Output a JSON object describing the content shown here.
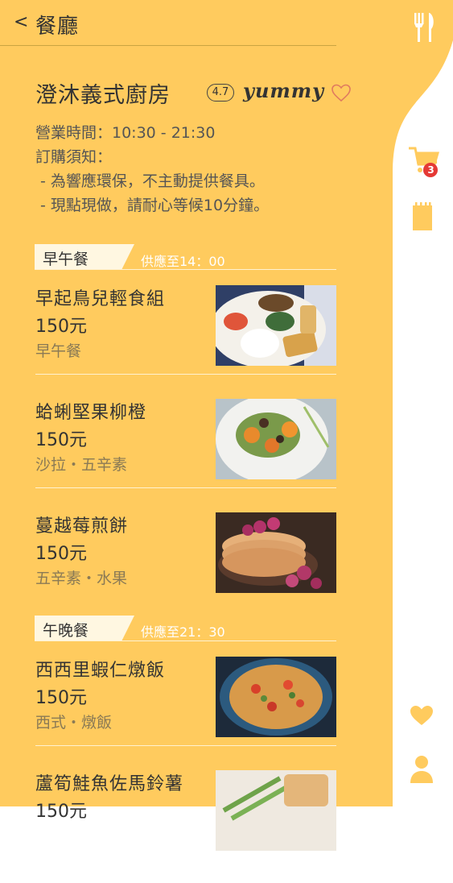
{
  "header": {
    "back_icon": "back-chevron-icon",
    "title": "餐廳"
  },
  "restaurant": {
    "name": "澄沐義式廚房",
    "rating": "4.7",
    "brand": "yummy",
    "hours": "營業時間：10:30 - 21:30",
    "notice_title": "訂購須知：",
    "notices": [
      "- 為響應環保，不主動提供餐具。",
      "- 現點現做，請耐心等候10分鐘。"
    ]
  },
  "sections": [
    {
      "label": "早午餐",
      "note": "供應至14：00",
      "items": [
        {
          "name": "早起鳥兒輕食組",
          "price": "150元",
          "tags": "早午餐",
          "photo": "breakfast-plate"
        },
        {
          "name": "蛤蜊堅果柳橙",
          "price": "150元",
          "tags": "沙拉・五辛素",
          "photo": "salad-bowl"
        },
        {
          "name": "蔓越莓煎餅",
          "price": "150元",
          "tags": "五辛素・水果",
          "photo": "pancakes"
        }
      ]
    },
    {
      "label": "午晚餐",
      "note": "供應至21：30",
      "items": [
        {
          "name": "西西里蝦仁燉飯",
          "price": "150元",
          "tags": "西式・燉飯",
          "photo": "shrimp-risotto"
        },
        {
          "name": "蘆筍鮭魚佐馬鈴薯",
          "price": "150元",
          "tags": "",
          "photo": "salmon-asparagus"
        }
      ]
    }
  ],
  "sidebar": {
    "cart_badge": "3",
    "icons": [
      "fork-knife-icon",
      "cart-icon",
      "notepad-icon",
      "heart-icon",
      "user-icon"
    ]
  },
  "colors": {
    "primary": "#ffcb5e",
    "text": "#333333",
    "muted": "#8a7a55",
    "badge": "#e53935"
  }
}
